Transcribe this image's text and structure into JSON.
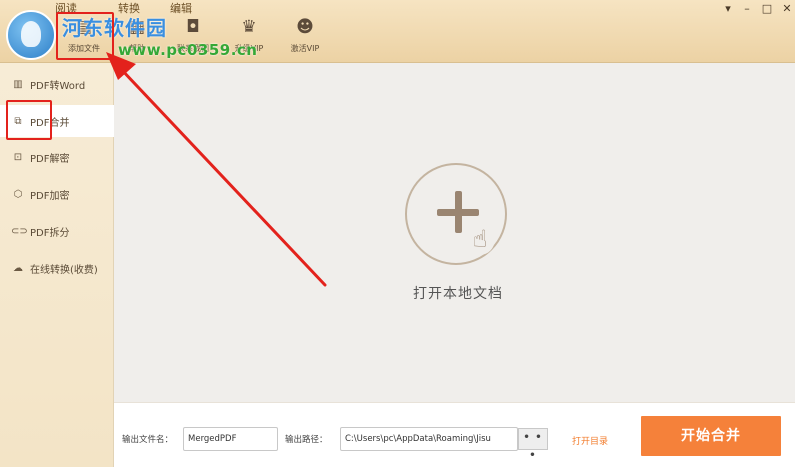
{
  "header": {
    "menu_tabs": [
      {
        "label": "阅读"
      },
      {
        "label": "转换"
      },
      {
        "label": "编辑"
      }
    ],
    "toolbar": [
      {
        "label": "添加文件",
        "icon": "add-file-icon"
      },
      {
        "label": "帮助",
        "icon": "help-icon"
      },
      {
        "label": "联系我们",
        "icon": "chat-icon"
      },
      {
        "label": "升级VIP",
        "icon": "crown-icon"
      },
      {
        "label": "激活VIP",
        "icon": "user-icon"
      }
    ],
    "watermark": {
      "text": "河东软件园",
      "url": "www.pc0359.cn"
    },
    "window_controls": {
      "skin": "▾",
      "minimize": "–",
      "maximize": "□",
      "close": "✕"
    }
  },
  "sidebar": {
    "items": [
      {
        "label": "PDF转Word",
        "icon": "word-icon",
        "active": false
      },
      {
        "label": "PDF合并",
        "icon": "merge-icon",
        "active": true
      },
      {
        "label": "PDF解密",
        "icon": "unlock-icon",
        "active": false
      },
      {
        "label": "PDF加密",
        "icon": "shield-icon",
        "active": false
      },
      {
        "label": "PDF拆分",
        "icon": "split-icon",
        "active": false
      },
      {
        "label": "在线转换(收费)",
        "icon": "cloud-icon",
        "active": false
      }
    ]
  },
  "main": {
    "open_label": "打开本地文档"
  },
  "bottom": {
    "output_name_label": "输出文件名：",
    "output_name_value": "MergedPDF",
    "output_path_label": "输出路径：",
    "output_path_value": "C:\\Users\\pc\\AppData\\Roaming\\Jisu",
    "browse_label": "• • •",
    "open_dir_label": "打开目录",
    "start_label": "开始合并"
  },
  "colors": {
    "accent": "#f5813a",
    "annotation": "#e3221c",
    "topbar": "#f0dbb4",
    "sidebar": "#f5e8cf"
  }
}
